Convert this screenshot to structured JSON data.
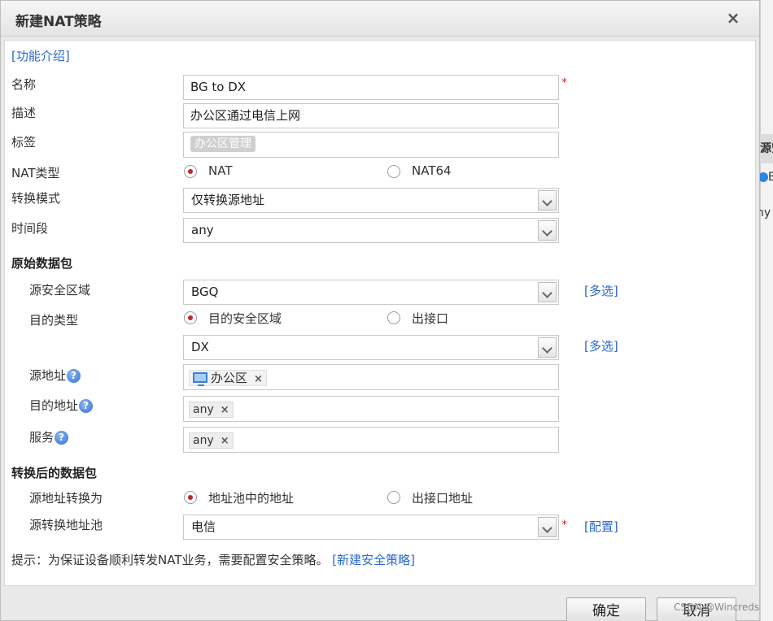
{
  "dialog": {
    "title": "新建NAT策略",
    "close_label": "×",
    "intro_link": "[功能介绍]"
  },
  "fields": {
    "name_label": "名称",
    "name_value": "BG to DX",
    "desc_label": "描述",
    "desc_value": "办公区通过电信上网",
    "tag_label": "标签",
    "tag_value": "办公区管理",
    "nat_type_label": "NAT类型",
    "nat_type_options": [
      "NAT",
      "NAT64"
    ],
    "nat_type_selected": "NAT",
    "mode_label": "转换模式",
    "mode_value": "仅转换源地址",
    "time_label": "时间段",
    "time_value": "any"
  },
  "original": {
    "section_title": "原始数据包",
    "src_zone_label": "源安全区域",
    "src_zone_value": "BGQ",
    "multi_select_link": "[多选]",
    "dst_type_label": "目的类型",
    "dst_type_options": [
      "目的安全区域",
      "出接口"
    ],
    "dst_type_selected": "目的安全区域",
    "dst_zone_value": "DX",
    "src_addr_label": "源地址",
    "src_addr_tag": "办公区",
    "dst_addr_label": "目的地址",
    "dst_addr_tag": "any",
    "service_label": "服务",
    "service_tag": "any",
    "help_glyph": "?"
  },
  "translated": {
    "section_title": "转换后的数据包",
    "src_trans_label": "源地址转换为",
    "src_trans_options": [
      "地址池中的地址",
      "出接口地址"
    ],
    "src_trans_selected": "地址池中的地址",
    "pool_label": "源转换地址池",
    "pool_value": "电信",
    "config_link": "[配置]"
  },
  "hint": {
    "text": "提示：为保证设备顺利转发NAT业务，需要配置安全策略。",
    "link": "[新建安全策略]"
  },
  "buttons": {
    "ok": "确定",
    "cancel": "取消"
  },
  "required_mark": "*",
  "tag_close": "×",
  "watermark": "CSDN @Wincreds",
  "background_page": {
    "col_header": "源安",
    "row1": "B",
    "row2": "ny"
  }
}
